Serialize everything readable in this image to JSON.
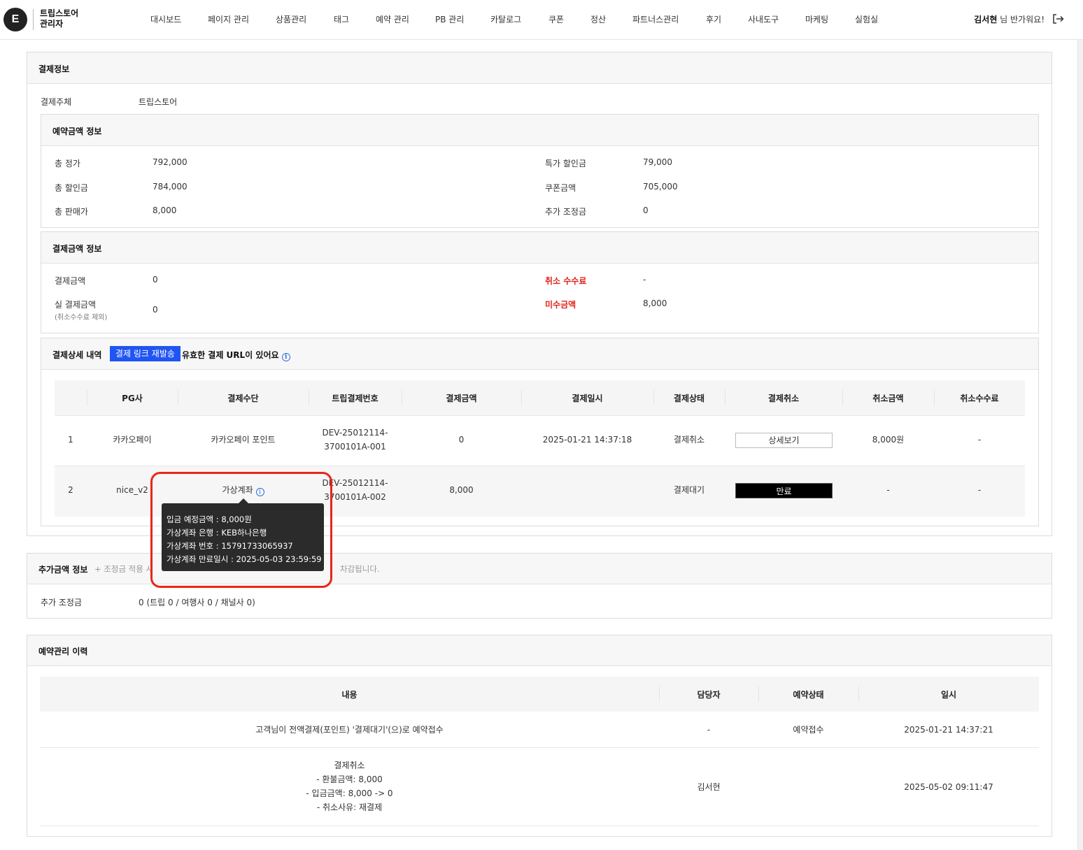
{
  "header": {
    "logo_letter": "E",
    "brand": "트립스토어\n관리자",
    "nav": [
      "대시보드",
      "페이지 관리",
      "상품관리",
      "태그",
      "예약 관리",
      "PB 관리",
      "카탈로그",
      "쿠폰",
      "정산",
      "파트너스관리",
      "후기",
      "사내도구",
      "마케팅",
      "실험실"
    ],
    "user_name": "김서현",
    "greeting_suffix": " 님 반가워요!"
  },
  "payment_info": {
    "title": "결제정보",
    "payer_label": "결제주체",
    "payer_value": "트립스토어",
    "reservation_amount": {
      "title": "예약금액 정보",
      "left": [
        {
          "label": "총 정가",
          "value": "792,000"
        },
        {
          "label": "총 할인금",
          "value": "784,000"
        },
        {
          "label": "총 판매가",
          "value": "8,000"
        }
      ],
      "right": [
        {
          "label": "특가 할인금",
          "value": "79,000"
        },
        {
          "label": "쿠폰금액",
          "value": "705,000"
        },
        {
          "label": "추가 조정금",
          "value": "0"
        }
      ]
    },
    "paid_amount": {
      "title": "결제금액 정보",
      "pay_amount_label": "결제금액",
      "pay_amount_value": "0",
      "actual_label": "실 결제금액",
      "actual_sub": "(취소수수료 제외)",
      "actual_value": "0",
      "cancel_fee_label": "취소 수수료",
      "cancel_fee_value": "-",
      "unpaid_label": "미수금액",
      "unpaid_value": "8,000"
    },
    "detail": {
      "title": "결제상세 내역",
      "resend_button": "결제 링크 재발송",
      "notice": "유효한 결제 URL이 있어요",
      "columns": [
        "PG사",
        "결제수단",
        "트립결제번호",
        "결제금액",
        "결제일시",
        "결제상태",
        "결제취소",
        "취소금액",
        "취소수수료"
      ],
      "rows": [
        {
          "no": "1",
          "pg": "카카오페이",
          "method": "카카오페이 포인트",
          "trip_no_1": "DEV-25012114-",
          "trip_no_2": "3700101A-001",
          "amount": "0",
          "datetime": "2025-01-21 14:37:18",
          "status": "결제취소",
          "cancel_action": "상세보기",
          "cancel_amount": "8,000원",
          "cancel_fee": "-"
        },
        {
          "no": "2",
          "pg": "nice_v2",
          "method": "가상계좌",
          "trip_no_1": "DEV-25012114-",
          "trip_no_2": "3700101A-002",
          "amount": "8,000",
          "datetime": "",
          "status": "결제대기",
          "cancel_action": "만료",
          "cancel_amount": "-",
          "cancel_fee": "-"
        }
      ],
      "tooltip": [
        "입금 예정금액 : 8,000원",
        "가상계좌 은행 : KEB하나은행",
        "가상계좌 번호 : 15791733065937",
        "가상계좌 만료일시 : 2025-05-03 23:59:59"
      ]
    }
  },
  "extra_amount": {
    "title": "추가금액 정보",
    "note": "+ 조정금 적용 시 할인금액 추가됩니다. (조정금 적용 시 판매금액에서 차감됩니다.",
    "note_visible_tail": "차감됩니다.",
    "adjust_label": "추가 조정금",
    "adjust_value": "0 (트립 0 / 여행사 0 / 채널사 0)"
  },
  "history": {
    "title": "예약관리 이력",
    "columns": [
      "내용",
      "담당자",
      "예약상태",
      "일시"
    ],
    "rows": [
      {
        "content": [
          "고객님이 전액결제(포인트) '결제대기'(으)로 예약접수"
        ],
        "manager": "-",
        "status": "예약접수",
        "datetime": "2025-01-21 14:37:21"
      },
      {
        "content": [
          "결제취소",
          "- 환불금액: 8,000",
          "- 입금금액: 8,000 -> 0",
          "- 취소사유: 재결제"
        ],
        "manager": "김서현",
        "status": "",
        "datetime": "2025-05-02 09:11:47"
      }
    ]
  },
  "colors": {
    "accent": "#1f55f3",
    "link": "#2f6fe0",
    "alert": "#e2231a",
    "highlight": "#e8261a"
  }
}
